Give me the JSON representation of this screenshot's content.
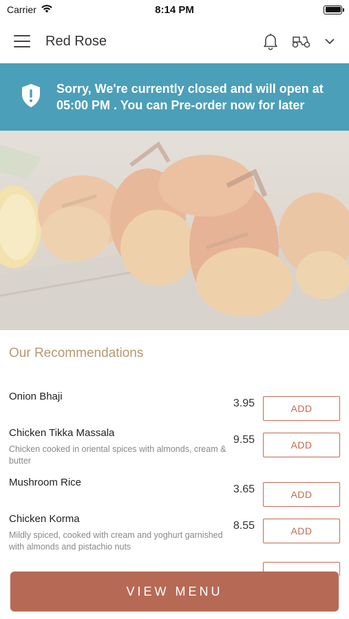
{
  "status_bar": {
    "carrier": "Carrier",
    "time": "8:14 PM"
  },
  "header": {
    "title": "Red Rose",
    "icons": [
      "menu-icon",
      "bell-icon",
      "scooter-icon",
      "chevron-down-icon"
    ]
  },
  "banner": {
    "message": "Sorry, We're currently closed and will open at 05:00 PM . You can Pre-order now for later",
    "icon": "shield-alert-icon",
    "color": "#4c9fb8"
  },
  "hero": {
    "image": "grilled-prawns-photo"
  },
  "recommendations": {
    "title": "Our Recommendations",
    "items": [
      {
        "name": "Onion Bhaji",
        "description": "",
        "price": "3.95",
        "button": "ADD"
      },
      {
        "name": "Chicken Tikka Massala",
        "description": "Chicken cooked in oriental spices with almonds, cream & butter",
        "price": "9.55",
        "button": "ADD"
      },
      {
        "name": "Mushroom Rice",
        "description": "",
        "price": "3.65",
        "button": "ADD"
      },
      {
        "name": "Chicken Korma",
        "description": "Mildly spiced, cooked with cream and yoghurt garnished with almonds and pistachio nuts",
        "price": "8.55",
        "button": "ADD"
      }
    ]
  },
  "footer": {
    "view_menu_label": "VIEW MENU",
    "color": "#b66a55"
  },
  "colors": {
    "accent": "#c26a53",
    "section_title": "#b39a73"
  }
}
